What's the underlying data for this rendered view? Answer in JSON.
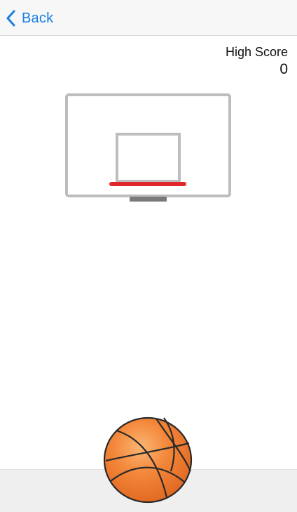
{
  "nav": {
    "back_label": "Back"
  },
  "score": {
    "label": "High Score",
    "value": "0"
  },
  "colors": {
    "accent": "#1a7de0",
    "rim": "#e0262b",
    "backboard": "#bdbdbd",
    "ball": "#f07a2e"
  },
  "icons": {
    "back": "chevron-left-icon",
    "ball": "basketball-icon"
  }
}
